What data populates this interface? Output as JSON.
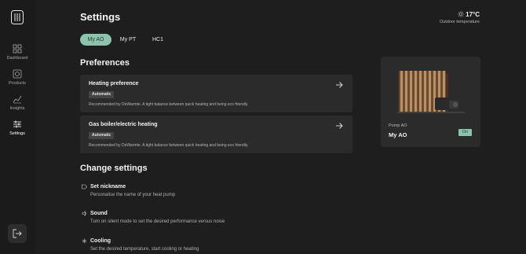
{
  "page": {
    "title": "Settings"
  },
  "weather": {
    "temperature": "17°C",
    "label": "Outdoor temperature"
  },
  "sidebar": {
    "items": [
      {
        "label": "Dashboard",
        "icon": "grid-icon",
        "active": false
      },
      {
        "label": "Products",
        "icon": "product-icon",
        "active": false
      },
      {
        "label": "Insights",
        "icon": "chart-icon",
        "active": false
      },
      {
        "label": "Settings",
        "icon": "sliders-icon",
        "active": true
      }
    ],
    "logout_icon": "logout-icon"
  },
  "tabs": [
    {
      "label": "My AO",
      "active": true
    },
    {
      "label": "My PT",
      "active": false
    },
    {
      "label": "HC1",
      "active": false
    }
  ],
  "preferences": {
    "heading": "Preferences",
    "cards": [
      {
        "title": "Heating preference",
        "badge": "Automatic",
        "description": "Recommended by DeWarmte. A tight balance between quick heating and being eco friendly."
      },
      {
        "title": "Gas boiler/electric heating",
        "badge": "Automatic",
        "description": "Recommended by DeWarmte. A tight balance between quick heating and being eco friendly."
      }
    ]
  },
  "pump": {
    "label": "Pomp AO",
    "name": "My AO",
    "status": "On",
    "status_color": "#8cc3ad"
  },
  "change_settings": {
    "heading": "Change settings",
    "items": [
      {
        "title": "Set nickname",
        "description": "Personalise the name of your heat pump",
        "icon": "tag-icon"
      },
      {
        "title": "Sound",
        "description": "Turn on silent mode to set the desired performance versus noise",
        "icon": "sound-icon"
      },
      {
        "title": "Cooling",
        "description": "Set the desired temperature, start cooling or heating",
        "icon": "snowflake-icon"
      }
    ]
  },
  "colors": {
    "accent": "#8cc3ad",
    "background": "#1e1e1e",
    "card": "#2b2b2b"
  }
}
